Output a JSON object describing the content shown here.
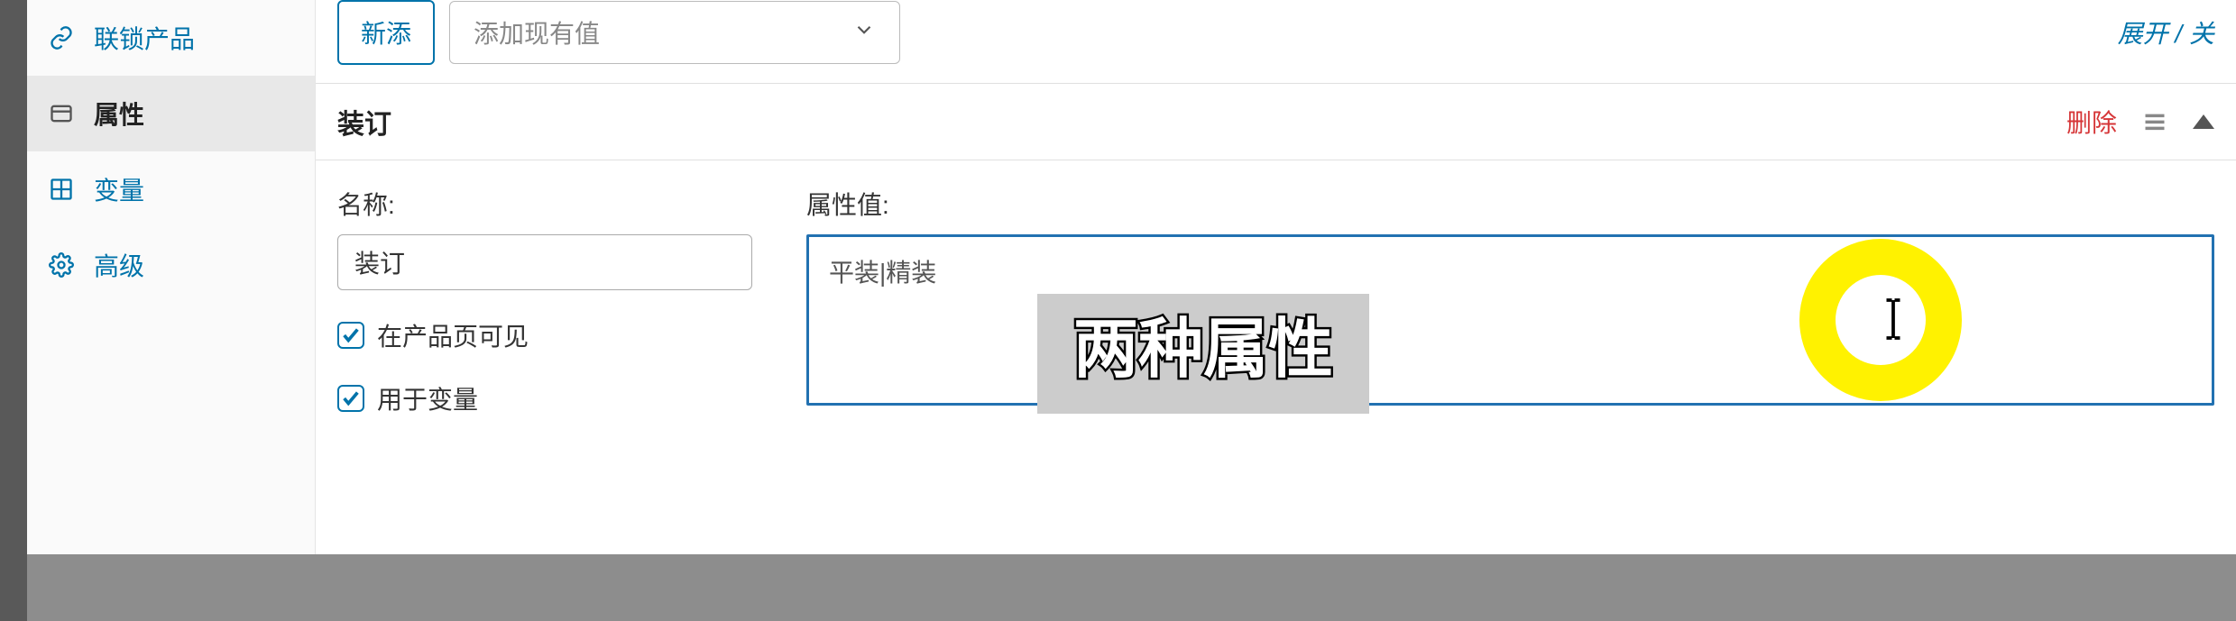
{
  "sidebar": {
    "items": [
      {
        "label": "联锁产品"
      },
      {
        "label": "属性"
      },
      {
        "label": "变量"
      },
      {
        "label": "高级"
      }
    ]
  },
  "toolbar": {
    "add_button": "新添",
    "dropdown_placeholder": "添加现有值",
    "expand_toggle": "展开 / 关"
  },
  "attribute": {
    "title": "装订",
    "delete_label": "删除",
    "name_label": "名称:",
    "name_value": "装订",
    "value_label": "属性值:",
    "value_content": "平装|精装",
    "visible_label": "在产品页可见",
    "used_label": "用于变量"
  },
  "caption": "两种属性"
}
